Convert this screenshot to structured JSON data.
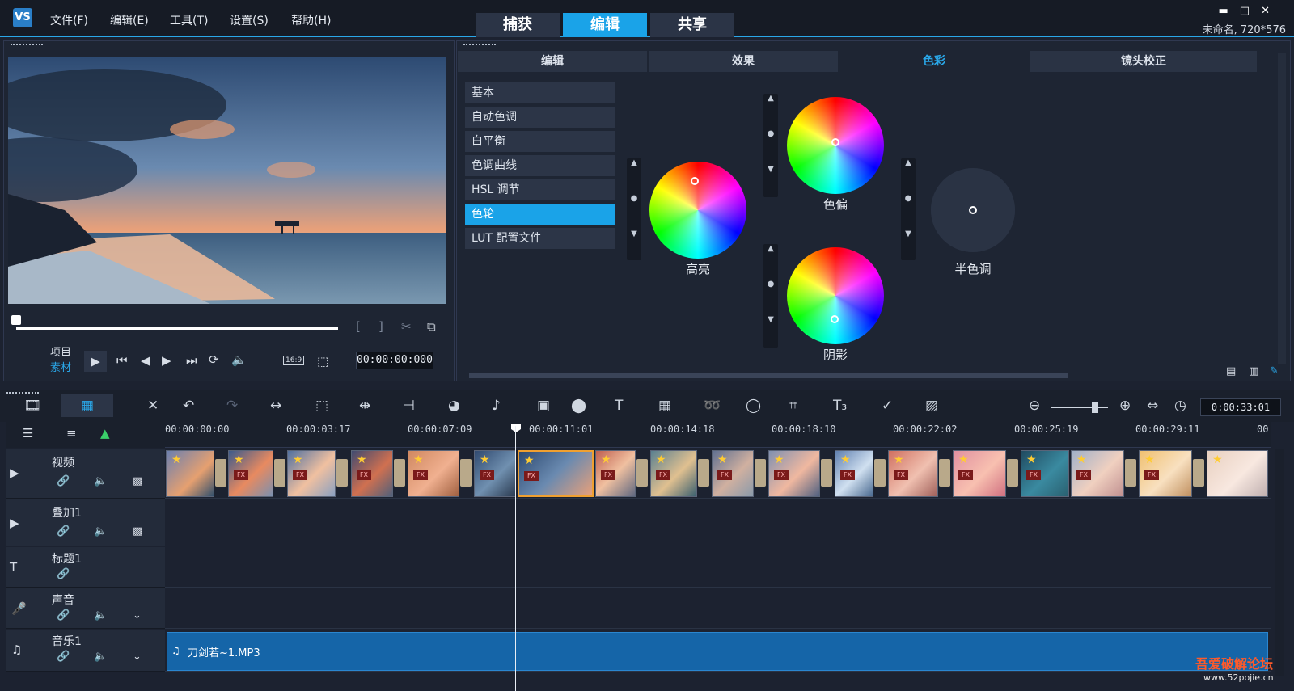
{
  "menu": [
    "文件(F)",
    "编辑(E)",
    "工具(T)",
    "设置(S)",
    "帮助(H)"
  ],
  "main_tabs": [
    {
      "label": "捕获",
      "active": false
    },
    {
      "label": "编辑",
      "active": true
    },
    {
      "label": "共享",
      "active": false
    }
  ],
  "project_info": "未命名, 720*576",
  "player": {
    "mode_project": "项目",
    "mode_clip": "素材",
    "timecode": "00:00:00:000",
    "aspect": "16:9"
  },
  "options": {
    "tabs": [
      {
        "label": "编辑",
        "active": false
      },
      {
        "label": "效果",
        "active": false
      },
      {
        "label": "色彩",
        "active": true
      },
      {
        "label": "镜头校正",
        "active": false
      }
    ],
    "categories": [
      {
        "label": "基本",
        "active": false
      },
      {
        "label": "自动色调",
        "active": false
      },
      {
        "label": "白平衡",
        "active": false
      },
      {
        "label": "色调曲线",
        "active": false
      },
      {
        "label": "HSL 调节",
        "active": false
      },
      {
        "label": "色轮",
        "active": true
      },
      {
        "label": "LUT 配置文件",
        "active": false
      }
    ],
    "wheels": {
      "highlight": "高亮",
      "cast": "色偏",
      "shadow": "阴影",
      "midtone": "半色调"
    }
  },
  "timeline": {
    "timecode": "0:00:33:01",
    "ruler": [
      "00:00:00:00",
      "00:00:03:17",
      "00:00:07:09",
      "00:00:11:01",
      "00:00:14:18",
      "00:00:18:10",
      "00:00:22:02",
      "00:00:25:19",
      "00:00:29:11",
      "00"
    ],
    "tracks": [
      {
        "name": "视频"
      },
      {
        "name": "叠加1"
      },
      {
        "name": "标题1"
      },
      {
        "name": "声音"
      },
      {
        "name": "音乐1"
      }
    ],
    "music_clip": "刀剑若~1.MP3"
  },
  "watermark": {
    "title": "吾爱破解论坛",
    "url": "www.52pojie.cn"
  },
  "colors": {
    "accent": "#1aa3e8",
    "background": "#1c2230"
  }
}
